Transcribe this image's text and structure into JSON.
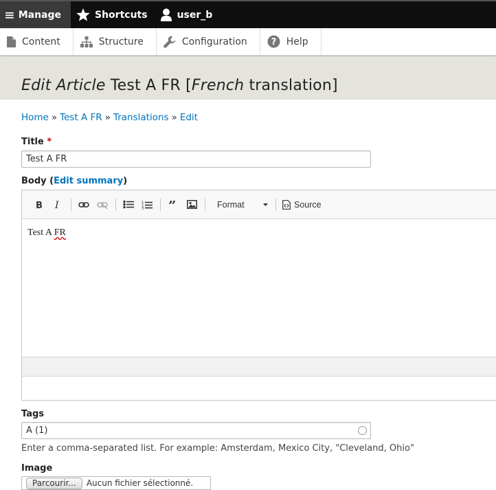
{
  "toolbar": {
    "manage_label": "Manage",
    "shortcuts_label": "Shortcuts",
    "user_label": "user_b"
  },
  "tray": {
    "items": [
      {
        "label": "Content",
        "icon": "file-icon"
      },
      {
        "label": "Structure",
        "icon": "sitemap-icon"
      },
      {
        "label": "Configuration",
        "icon": "wrench-icon"
      },
      {
        "label": "Help",
        "icon": "help-icon"
      }
    ]
  },
  "page": {
    "title_part1": "Edit Article",
    "title_part2": " Test A FR [",
    "title_part3": "French",
    "title_part4": " translation]"
  },
  "breadcrumb": [
    "Home",
    "Test A FR",
    "Translations",
    "Edit"
  ],
  "form": {
    "title_label": "Title",
    "title_required": "*",
    "title_value": "Test A FR",
    "body_label": "Body (",
    "body_edit_summary": "Edit summary",
    "body_label_end": ")",
    "editor_format_label": "Format",
    "editor_source_label": "Source",
    "editor_text_1": "Test A ",
    "editor_text_2": "FR",
    "tags_label": "Tags",
    "tags_value": "A (1)",
    "tags_help": "Enter a comma-separated list. For example: Amsterdam, Mexico City, \"Cleveland, Ohio\"",
    "image_label": "Image",
    "file_button_label": "Parcourir...",
    "file_status": "Aucun fichier sélectionné."
  }
}
